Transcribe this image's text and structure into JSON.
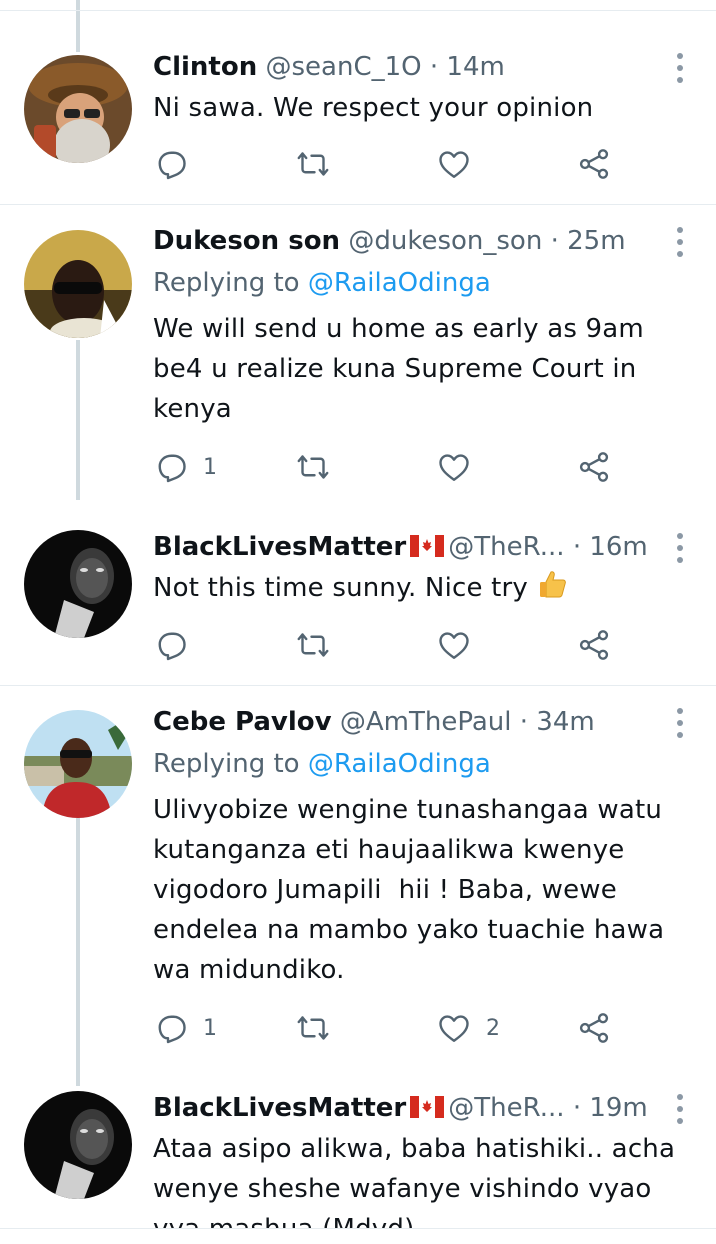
{
  "tweets": [
    {
      "name": "Clinton",
      "handle": "@seanC_1O",
      "time": "14m",
      "reply_prefix": "",
      "reply_mention": "",
      "text": "Ni sawa. We respect your opinion",
      "reply_count": "",
      "like_count": "",
      "flag": false
    },
    {
      "name": "Dukeson son",
      "handle": "@dukeson_son",
      "time": "25m",
      "reply_prefix": "Replying to ",
      "reply_mention": "@RailaOdinga",
      "text": "We will send u home as early as 9am\nbe4 u realize kuna Supreme Court in\nkenya",
      "reply_count": "1",
      "like_count": "",
      "flag": false
    },
    {
      "name": "BlackLivesMatter",
      "handle": "@TheR...",
      "time": "16m",
      "reply_prefix": "",
      "reply_mention": "",
      "text": "Not this time sunny. Nice try",
      "reply_count": "",
      "like_count": "",
      "flag": true
    },
    {
      "name": "Cebe Pavlov",
      "handle": "@AmThePaul",
      "time": "34m",
      "reply_prefix": "Replying to ",
      "reply_mention": "@RailaOdinga",
      "text": "Ulivyobize wengine tunashangaa watu\nkutanganza eti haujaalikwa kwenye\nvigodoro Jumapili  hii ! Baba, wewe\nendelea na mambo yako tuachie hawa\nwa midundiko.",
      "reply_count": "1",
      "like_count": "2",
      "flag": false
    },
    {
      "name": "BlackLivesMatter",
      "handle": "@TheR...",
      "time": "19m",
      "reply_prefix": "",
      "reply_mention": "",
      "text": "Ataa asipo alikwa, baba hatishiki.. acha\nwenye sheshe wafanye vishindo vyao\nvya mashua (Mdvd)",
      "reply_count": "",
      "like_count": "",
      "flag": true
    }
  ],
  "dot_separator": "·",
  "icons": {
    "reply": "reply-icon",
    "retweet": "retweet-icon",
    "like": "heart-icon",
    "share": "share-icon",
    "more": "more-vertical-icon",
    "flag": "canada-flag-icon",
    "emoji": "thumbs-up-emoji"
  },
  "colors": {
    "link": "#1d9bf0",
    "secondary_text": "#536471",
    "primary_text": "#0f1419",
    "thread_line": "#cfd9de"
  }
}
